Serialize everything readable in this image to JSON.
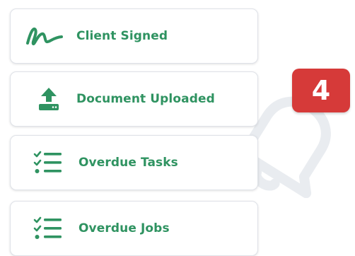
{
  "accent_color": "#2f9361",
  "badge_color": "#d63a39",
  "items": [
    {
      "label": "Client Signed",
      "icon": "signature-icon"
    },
    {
      "label": "Document Uploaded",
      "icon": "upload-icon"
    },
    {
      "label": "Overdue Tasks",
      "icon": "checklist-icon"
    },
    {
      "label": "Overdue Jobs",
      "icon": "checklist-icon"
    }
  ],
  "notification": {
    "count": "4",
    "icon": "bell-icon"
  }
}
